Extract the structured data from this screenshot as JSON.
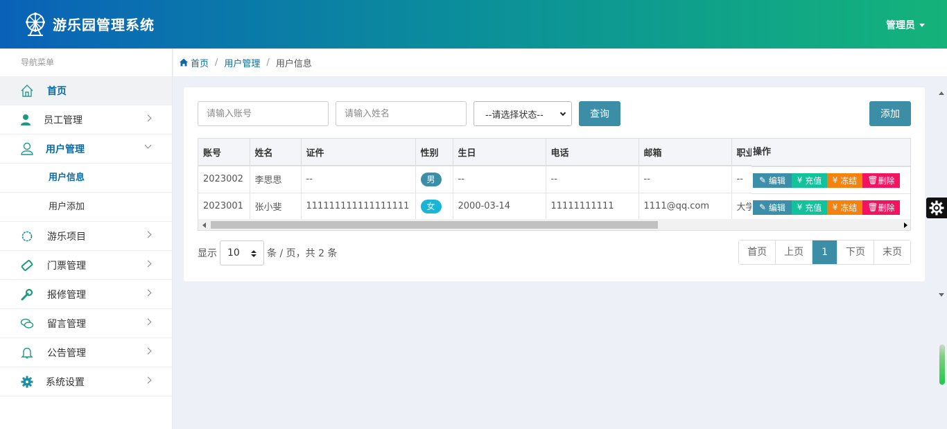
{
  "header": {
    "app_title": "游乐园管理系统",
    "admin_label": "管理员"
  },
  "sidebar": {
    "heading": "导航菜单",
    "items": [
      {
        "label": "首页",
        "icon": "home-icon",
        "active": true
      },
      {
        "label": "员工管理",
        "icon": "person-icon"
      },
      {
        "label": "用户管理",
        "icon": "user-outline-icon",
        "open": true
      },
      {
        "label": "游乐项目",
        "icon": "cog-ring-icon"
      },
      {
        "label": "门票管理",
        "icon": "ticket-icon"
      },
      {
        "label": "报修管理",
        "icon": "wrench-icon"
      },
      {
        "label": "留言管理",
        "icon": "chat-bubbles-icon"
      },
      {
        "label": "公告管理",
        "icon": "bell-icon"
      },
      {
        "label": "系统设置",
        "icon": "gear-icon"
      }
    ],
    "subitems": [
      {
        "label": "用户信息",
        "current": true
      },
      {
        "label": "用户添加"
      }
    ]
  },
  "breadcrumb": {
    "home": "首页",
    "section": "用户管理",
    "current": "用户信息",
    "separator": "/"
  },
  "search": {
    "account_placeholder": "请输入账号",
    "name_placeholder": "请输入姓名",
    "status_selected": "--请选择状态--",
    "query_label": "查询",
    "add_label": "添加"
  },
  "table": {
    "headers": [
      "账号",
      "姓名",
      "证件",
      "性别",
      "生日",
      "电话",
      "邮箱",
      "职业",
      "操作"
    ],
    "rows": [
      {
        "account": "2023002",
        "name": "李思思",
        "id_card": "--",
        "gender": "男",
        "birthday": "--",
        "phone": "--",
        "email": "--",
        "job": "--"
      },
      {
        "account": "2023001",
        "name": "张小斐",
        "id_card": "111111111111111111",
        "gender": "女",
        "birthday": "2000-03-14",
        "phone": "11111111111",
        "email": "1111@qq.com",
        "job": "大学"
      }
    ],
    "actions": {
      "edit": "编辑",
      "charge": "充值",
      "freeze": "冻结",
      "delete": "删除"
    },
    "gender_colors": {
      "男": "#3b8ea5",
      "女": "#17b6d6"
    }
  },
  "pagination": {
    "show_label": "显示",
    "page_size": "10",
    "suffix": "条 / 页，共 2 条",
    "first": "首页",
    "prev": "上页",
    "current": "1",
    "next": "下页",
    "last": "末页"
  },
  "colors": {
    "accent": "#3b8ea5",
    "link": "#0b6ba0",
    "edit": "#3d8ea8",
    "charge": "#13c29b",
    "freeze": "#f5820f",
    "delete": "#f2145e"
  }
}
